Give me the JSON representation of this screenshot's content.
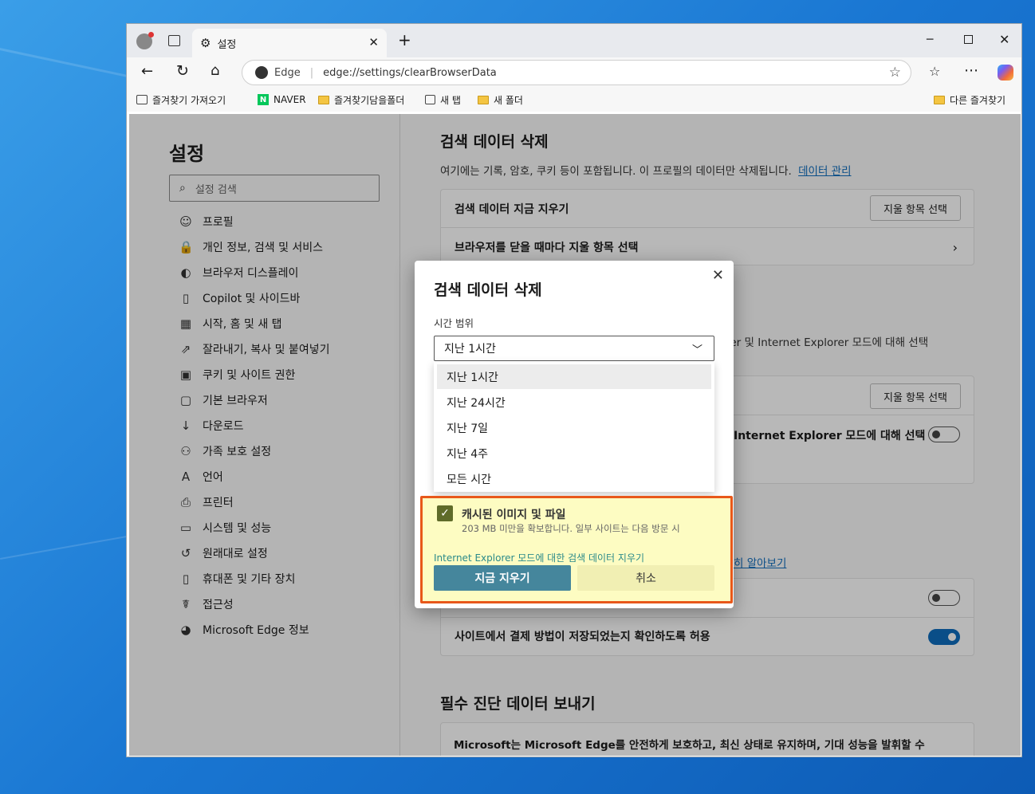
{
  "browser": {
    "tab_title": "설정",
    "address_site": "Edge",
    "address_url": "edge://settings/clearBrowserData",
    "bookmarks": [
      "즐겨찾기 가져오기",
      "NAVER",
      "즐겨찾기담을폴더",
      "새 탭",
      "새 폴더",
      "다른 즐겨찾기"
    ]
  },
  "sidebar": {
    "title": "설정",
    "search_placeholder": "설정 검색",
    "items": [
      {
        "label": "프로필",
        "icon": "profile-icon"
      },
      {
        "label": "개인 정보, 검색 및 서비스",
        "icon": "lock-icon"
      },
      {
        "label": "브라우저 디스플레이",
        "icon": "palette-icon"
      },
      {
        "label": "Copilot 및 사이드바",
        "icon": "sidebar-icon"
      },
      {
        "label": "시작, 홈 및 새 탭",
        "icon": "home-grid-icon"
      },
      {
        "label": "잘라내기, 복사 및 붙여넣기",
        "icon": "share-icon"
      },
      {
        "label": "쿠키 및 사이트 권한",
        "icon": "cookie-icon"
      },
      {
        "label": "기본 브라우저",
        "icon": "browser-icon"
      },
      {
        "label": "다운로드",
        "icon": "download-icon"
      },
      {
        "label": "가족 보호 설정",
        "icon": "family-icon"
      },
      {
        "label": "언어",
        "icon": "language-icon"
      },
      {
        "label": "프린터",
        "icon": "printer-icon"
      },
      {
        "label": "시스템 및 성능",
        "icon": "system-icon"
      },
      {
        "label": "원래대로 설정",
        "icon": "reset-icon"
      },
      {
        "label": "휴대폰 및 기타 장치",
        "icon": "phone-icon"
      },
      {
        "label": "접근성",
        "icon": "accessibility-icon"
      },
      {
        "label": "Microsoft Edge 정보",
        "icon": "edge-logo-icon"
      }
    ]
  },
  "main": {
    "section_title": "검색 데이터 삭제",
    "section_desc": "여기에는 기록, 암호, 쿠키 등이 포함됩니다. 이 프로필의 데이터만 삭제됩니다.",
    "manage_link": "데이터 관리",
    "clear_now_label": "검색 데이터 지금 지우기",
    "choose_button": "지울 항목 선택",
    "on_close_label": "브라우저를 닫을 때마다 지울 항목 선택",
    "ie_fragment": "Explorer 및 Internet Explorer 모드에 대해 선택",
    "choose_button_2": "지울 항목 선택",
    "ie_row_fragment": "Internet Explorer 모드에 대해 선택",
    "learn_more_fragment": "히 알아보기",
    "payment_label": "사이트에서 결제 방법이 저장되었는지 확인하도록 허용",
    "diag_title": "필수 진단 데이터 보내기",
    "diag_desc": "Microsoft는 Microsoft Edge를 안전하게 보호하고, 최신 상태로 유지하며, 기대 성능을 발휘할 수"
  },
  "dialog": {
    "title": "검색 데이터 삭제",
    "time_range_label": "시간 범위",
    "selected": "지난 1시간",
    "options": [
      "지난 1시간",
      "지난 24시간",
      "지난 7일",
      "지난 4주",
      "모든 시간"
    ],
    "cache_label": "캐시된 이미지 및 파일",
    "cache_desc": "203 MB 미만을 확보합니다. 일부 사이트는 다음 방문 시",
    "ie_link": "Internet Explorer 모드에 대한 검색 데이터 지우기",
    "clear_now": "지금 지우기",
    "cancel": "취소"
  },
  "colors": {
    "accent": "#0f6cbd",
    "primary_button": "#2e8bab",
    "highlight_border": "#e8581a",
    "highlight_fill": "#fdfcc2"
  }
}
